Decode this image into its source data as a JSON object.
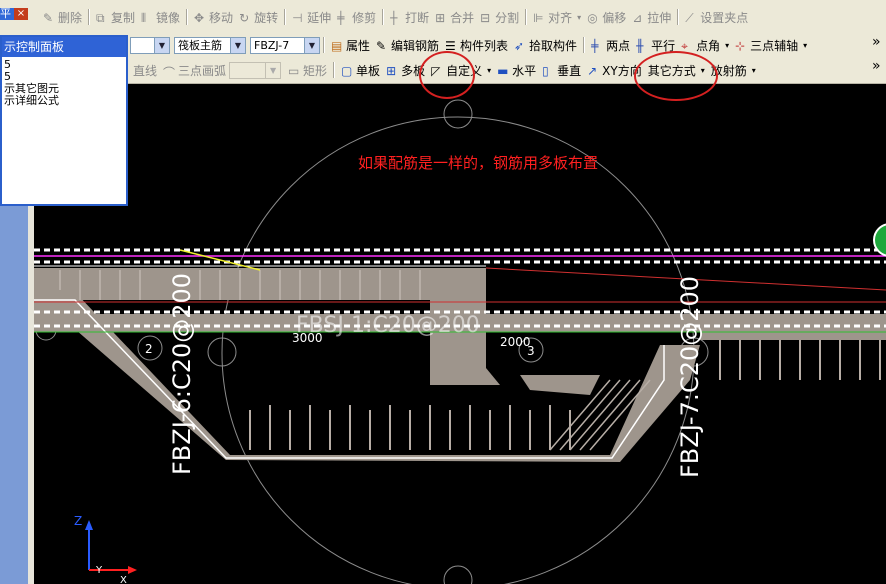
{
  "toolbar1": {
    "delete": "删除",
    "copy": "复制",
    "mirror": "镜像",
    "move": "移动",
    "rotate": "旋转",
    "extend": "延伸",
    "trim": "修剪",
    "break": "打断",
    "merge": "合并",
    "split": "分割",
    "align": "对齐",
    "offset": "偏移",
    "stretch": "拉伸",
    "set_grip": "设置夹点"
  },
  "toolbar2": {
    "rebar_type": "筏板主筋",
    "rebar_name": "FBZJ-7",
    "properties": "属性",
    "edit_rebar": "编辑钢筋",
    "component_list": "构件列表",
    "pick_component": "拾取构件",
    "two_points": "两点",
    "parallel": "平行",
    "point_angle": "点角",
    "three_point_aux": "三点辅轴",
    "more": "»"
  },
  "toolbar3": {
    "line": "直线",
    "arc3": "三点画弧",
    "rect": "矩形",
    "single_slab": "单板",
    "multi_slab": "多板",
    "custom": "自定义",
    "horizontal": "水平",
    "vertical": "垂直",
    "xy_direction": "XY方向",
    "other_methods": "其它方式",
    "radial_rebar": "放射筋",
    "more": "»"
  },
  "panel": {
    "title_tab": "平",
    "close": "×",
    "title": "示控制面板",
    "items": [
      "5",
      "5",
      "示其它图元",
      "示详细公式"
    ]
  },
  "canvas": {
    "annotation": "如果配筋是一样的，钢筋用多板布置",
    "label_left": "FBZJ-6:C20@200",
    "label_right": "FBZJ-7:C20@200",
    "label_center": "FBSJ-1:C20@200",
    "dim_left": "3000",
    "dim_right": "2000",
    "axis_2": "2",
    "axis_3": "3",
    "axis_z": "Z",
    "axis_y": "Y",
    "axis_x": "X"
  }
}
